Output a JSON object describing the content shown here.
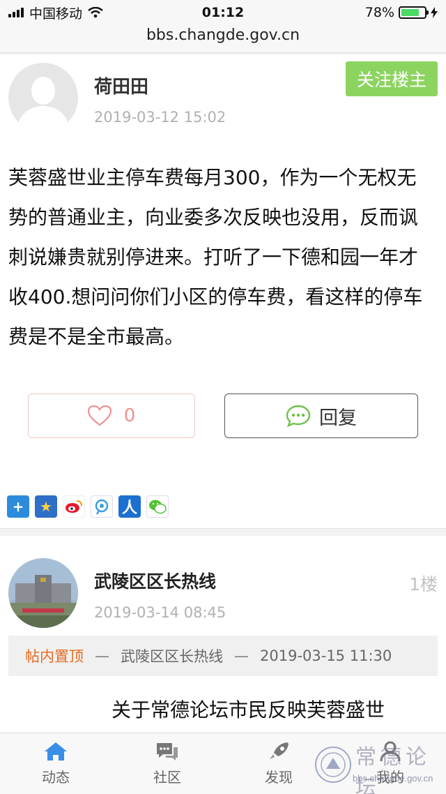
{
  "status_bar": {
    "carrier": "中国移动",
    "time": "01:12",
    "battery": "78%",
    "battery_level": 0.78
  },
  "browser": {
    "url": "bbs.changde.gov.cn"
  },
  "post": {
    "author": "荷田田",
    "date": "2019-03-12 15:02",
    "follow_label": "关注楼主",
    "body": "芙蓉盛世业主停车费每月300，作为一个无权无势的普通业主，向业委多次反映也没用，反而讽刺说嫌贵就别停进来。打听了一下德和园一年才收400.想问问你们小区的停车费，看这样的停车费是不是全市最高。",
    "like_count": "0",
    "reply_label": "回复",
    "share_icons": [
      "plus-icon",
      "qzone-star-icon",
      "weibo-icon",
      "tencent-weibo-icon",
      "renren-icon",
      "wechat-icon"
    ]
  },
  "reply": {
    "author": "武陵区区长热线",
    "date": "2019-03-14 08:45",
    "floor": "1楼",
    "pin_tag": "帖内置顶",
    "pin_sep": "—",
    "pin_author": "武陵区区长热线",
    "pin_date": "2019-03-15 11:30",
    "text": "关于常德论坛市民反映芙蓉盛世"
  },
  "bottom_nav": {
    "items": [
      {
        "label": "动态",
        "icon": "home-icon",
        "active": true
      },
      {
        "label": "社区",
        "icon": "chat-bubbles-icon",
        "active": false
      },
      {
        "label": "发现",
        "icon": "rocket-icon",
        "active": false
      },
      {
        "label": "我的",
        "icon": "user-icon",
        "active": false
      }
    ]
  },
  "watermark": {
    "title": "常德论坛",
    "url": "bbs.changde.gov.cn"
  },
  "colors": {
    "follow_green": "#8cd460",
    "pin_orange": "#e76b1f",
    "nav_active": "#3a8ee6",
    "battery_green": "#4cd964"
  }
}
